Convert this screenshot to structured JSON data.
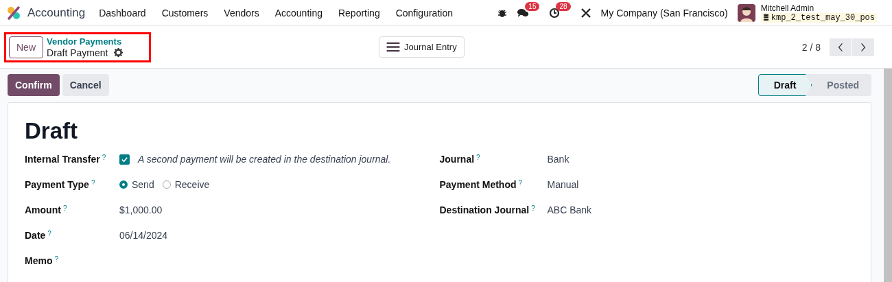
{
  "navbar": {
    "app_name": "Accounting",
    "menu": [
      "Dashboard",
      "Customers",
      "Vendors",
      "Accounting",
      "Reporting",
      "Configuration"
    ],
    "messages_count": "15",
    "activities_count": "28",
    "company": "My Company (San Francisco)",
    "user": "Mitchell Admin",
    "database": "kmp_2_test_may_30_pos"
  },
  "control_panel": {
    "new_button": "New",
    "breadcrumb": "Vendor Payments",
    "record": "Draft Payment",
    "highlighted": true,
    "view_button": "Journal Entry",
    "pager": "2 / 8"
  },
  "actions": [
    {
      "label": "Confirm",
      "primary": true
    },
    {
      "label": "Cancel",
      "primary": false
    }
  ],
  "statusbar": [
    {
      "label": "Draft",
      "selected": true
    },
    {
      "label": "Posted",
      "selected": false
    }
  ],
  "form": {
    "title": "Draft",
    "left": [
      {
        "kind": "checkbox",
        "label": "Internal Transfer",
        "help": "?",
        "checked": true,
        "value": "A second payment will be created in the destination journal."
      },
      {
        "kind": "radio",
        "label": "Payment Type",
        "help": "?",
        "options": [
          {
            "label": "Send",
            "selected": true
          },
          {
            "label": "Receive",
            "selected": false
          }
        ]
      },
      {
        "kind": "text",
        "label": "Amount",
        "help": "?",
        "value": "$1,000.00"
      },
      {
        "kind": "text",
        "label": "Date",
        "help": "?",
        "value": "06/14/2024"
      },
      {
        "kind": "text",
        "label": "Memo",
        "help": "?"
      }
    ],
    "right": [
      {
        "label": "Journal",
        "help": "?",
        "value": "Bank"
      },
      {
        "label": "Payment Method",
        "help": "?",
        "value": "Manual"
      },
      {
        "label": "Destination Journal",
        "help": "?",
        "value": "ABC Bank"
      }
    ]
  }
}
